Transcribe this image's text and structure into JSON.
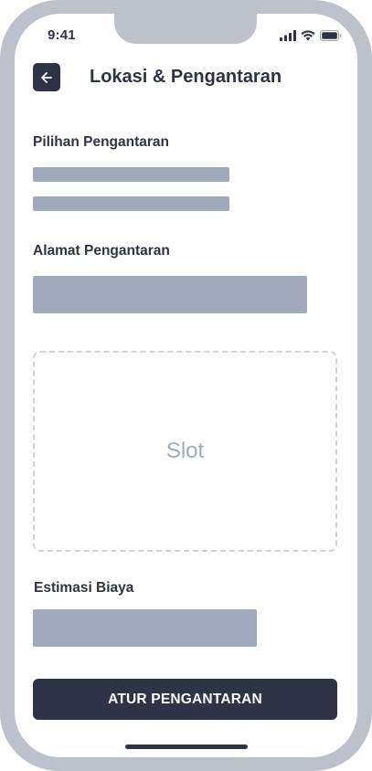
{
  "status_bar": {
    "time": "9:41"
  },
  "header": {
    "back_icon": "arrow-left-icon",
    "title": "Lokasi & Pengantaran"
  },
  "delivery_options": {
    "label": "Pilihan Pengantaran"
  },
  "delivery_address": {
    "label": "Alamat Pengantaran"
  },
  "slot": {
    "label": "Slot"
  },
  "cost_estimate": {
    "label": "Estimasi Biaya"
  },
  "cta": {
    "label": "ATUR PENGANTARAN"
  },
  "colors": {
    "primary": "#2e3446",
    "placeholder": "#a1aabc",
    "bezel": "#bcc1cb",
    "dashed_border": "#cfd3db",
    "background": "#ffffff"
  }
}
